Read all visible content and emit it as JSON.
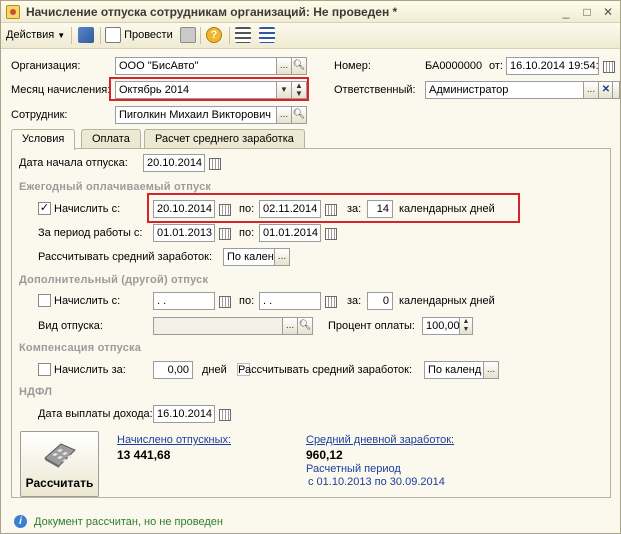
{
  "window": {
    "title": "Начисление отпуска сотрудникам организаций: Не проведен *",
    "controls": [
      "_",
      "□",
      "✕"
    ]
  },
  "toolbar": {
    "actions_label": "Действия",
    "post_label": "Провести"
  },
  "header": {
    "org_label": "Организация:",
    "org_value": "ООО \"БисАвто\"",
    "number_label": "Номер:",
    "number_value": "БА0000000",
    "from_label": "от:",
    "date_value": "16.10.2014 19:54:",
    "month_label": "Месяц начисления:",
    "month_value": "Октябрь 2014",
    "responsible_label": "Ответственный:",
    "responsible_value": "Администратор",
    "employee_label": "Сотрудник:",
    "employee_value": "Пиголкин Михаил Викторович"
  },
  "tabs": [
    {
      "label": "Условия",
      "active": true
    },
    {
      "label": "Оплата",
      "active": false
    },
    {
      "label": "Расчет среднего заработка",
      "active": false
    }
  ],
  "conditions": {
    "start_label": "Дата начала отпуска:",
    "start_value": "20.10.2014",
    "annual": {
      "header": "Ежегодный оплачиваемый отпуск",
      "accrue_label": "Начислить с:",
      "accrue_checked": true,
      "from_value": "20.10.2014",
      "to_label": "по:",
      "to_value": "02.11.2014",
      "for_label": "за:",
      "days_value": "14",
      "days_unit": "календарных дней",
      "period_label": "За период работы с:",
      "period_from": "01.01.2013",
      "period_to_label": "по:",
      "period_to": "01.01.2014",
      "avg_label": "Рассчитывать средний заработок:",
      "avg_value": "По кален"
    },
    "additional": {
      "header": "Дополнительный (другой) отпуск",
      "accrue_label": "Начислить с:",
      "from_value": " .  .",
      "to_label": "по:",
      "to_value": " .  .",
      "for_label": "за:",
      "days_value": "0",
      "days_unit": "календарных дней",
      "type_label": "Вид отпуска:",
      "type_value": "",
      "pct_label": "Процент оплаты:",
      "pct_value": "100,00"
    },
    "compensation": {
      "header": "Компенсация отпуска",
      "accrue_label": "Начислить за:",
      "days_value": "0,00",
      "days_unit": "дней",
      "avg_label": "Рассчитывать средний заработок:",
      "avg_value": "По календ"
    },
    "ndfl": {
      "header": "НДФЛ",
      "pay_date_label": "Дата выплаты дохода:",
      "pay_date_value": "16.10.2014"
    }
  },
  "summary": {
    "calc_button": "Рассчитать",
    "accrued_label": "Начислено отпускных:",
    "accrued_value": "13 441,68",
    "avg_label": "Средний дневной заработок:",
    "avg_value": "960,12",
    "period_label": "Расчетный период",
    "period_value": "с 01.10.2013 по 30.09.2014"
  },
  "status": {
    "text": "Документ рассчитан, но не проведен"
  }
}
